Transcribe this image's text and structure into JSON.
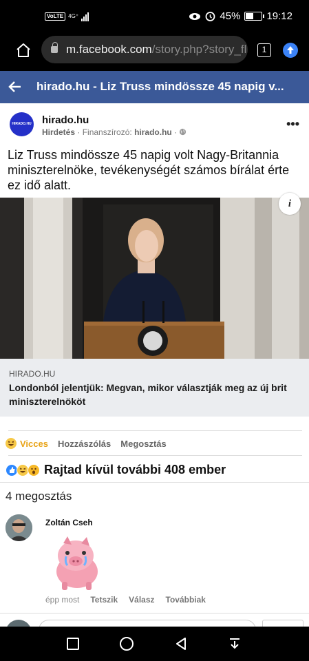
{
  "status_bar": {
    "volte": "VoLTE",
    "network": "4G⁺",
    "battery_percent": "45%",
    "time": "19:12",
    "icons": [
      "eye-icon",
      "alarm-icon",
      "battery-icon",
      "signal-icon"
    ]
  },
  "browser": {
    "url_host": "m.facebook.com",
    "url_path": "/story.php?story_fl",
    "tab_count": "1"
  },
  "header": {
    "title": "hirado.hu - Liz Truss mindössze 45 napig v..."
  },
  "post": {
    "logo_text": "HIRADO.HU",
    "page_name": "hirado.hu",
    "ad_label": "Hirdetés",
    "sponsor_label": "Finanszírozó:",
    "sponsor_name": "hirado.hu",
    "text": "Liz Truss mindössze 45 napig volt Nagy-Britannia miniszterelnöke, tevékenységét számos bírálat érte ez idő alatt.",
    "info_label": "i"
  },
  "link": {
    "domain": "HIRADO.HU",
    "headline": "Londonból jelentjük: Megvan, mikor választják meg az új brit miniszterelnököt"
  },
  "actions": {
    "react_label": "Vicces",
    "comment_label": "Hozzászólás",
    "share_label": "Megosztás"
  },
  "reactions": {
    "summary": "Rajtad kívül további 408 ember"
  },
  "shares": {
    "text": "4 megosztás"
  },
  "comment": {
    "author": "Zoltán Cseh",
    "time": "épp most",
    "like_label": "Tetszik",
    "reply_label": "Válasz",
    "more_label": "Továbbiak"
  },
  "colors": {
    "fb_blue": "#3b5998",
    "link_bg": "#ebedf0",
    "haha_yellow": "#e8a317"
  }
}
